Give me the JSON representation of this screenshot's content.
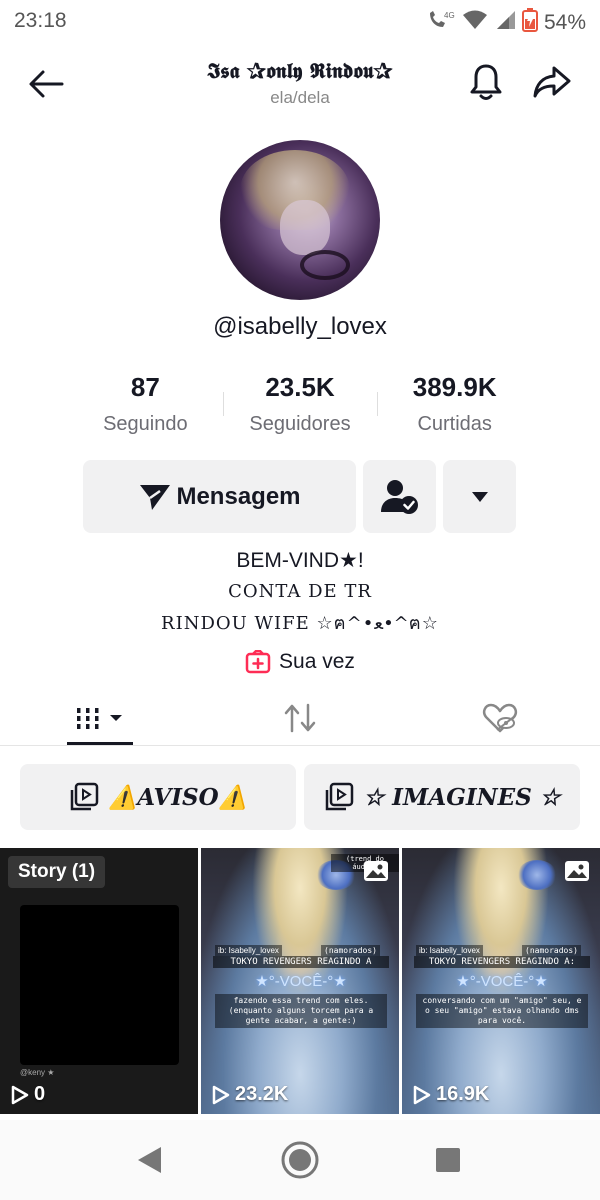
{
  "status_bar": {
    "time": "23:18",
    "network": "4G",
    "battery": "54%"
  },
  "header": {
    "title": "𝕴𝖘𝖆 ✰𝖔𝖓𝖑𝖞 𝕽𝖎𝖓𝖉𝖔𝖚✰",
    "pronouns": "ela/dela"
  },
  "profile": {
    "username": "@isabelly_lovex"
  },
  "stats": [
    {
      "value": "87",
      "label": "Seguindo"
    },
    {
      "value": "23.5K",
      "label": "Seguidores"
    },
    {
      "value": "389.9K",
      "label": "Curtidas"
    }
  ],
  "actions": {
    "message_label": "Mensagem"
  },
  "bio": {
    "line1": "BEM-VIND★!",
    "line2": "CONTA DE TR",
    "line3": "RINDOU WIFE ☆ฅ^•ﻌ•^ฅ☆"
  },
  "sua_vez": {
    "label": "Sua vez"
  },
  "playlists": [
    {
      "label": "⚠️AVISO⚠️"
    },
    {
      "label": "☆ IMAGINES ☆"
    }
  ],
  "grid": {
    "story_label": "Story (1)",
    "story_credit": "@keny ★",
    "items": [
      {
        "views": "0"
      },
      {
        "views": "23.2K",
        "tag": "(trend do áudio)",
        "ib": "ib: Isabelly_lovex",
        "namorados": "(namorados)",
        "headline": "TOKYO REVENGERS REAGINDO A",
        "voce": "★°-VOCÊ-°★",
        "body": "fazendo essa trend com eles. (enquanto alguns torcem para a gente acabar, a gente:)"
      },
      {
        "views": "16.9K",
        "ib": "ib: Isabelly_lovex",
        "namorados": "(namorados)",
        "headline": "TOKYO REVENGERS REAGINDO A:",
        "voce": "★°-VOCÊ-°★",
        "body": "conversando com um \"amigo\" seu, e o seu \"amigo\" estava olhando dms para você."
      }
    ]
  },
  "colors": {
    "text_primary": "#161823",
    "text_secondary": "#6d6d74",
    "button_bg": "#f1f1f2",
    "accent_pink": "#fe2c55"
  }
}
